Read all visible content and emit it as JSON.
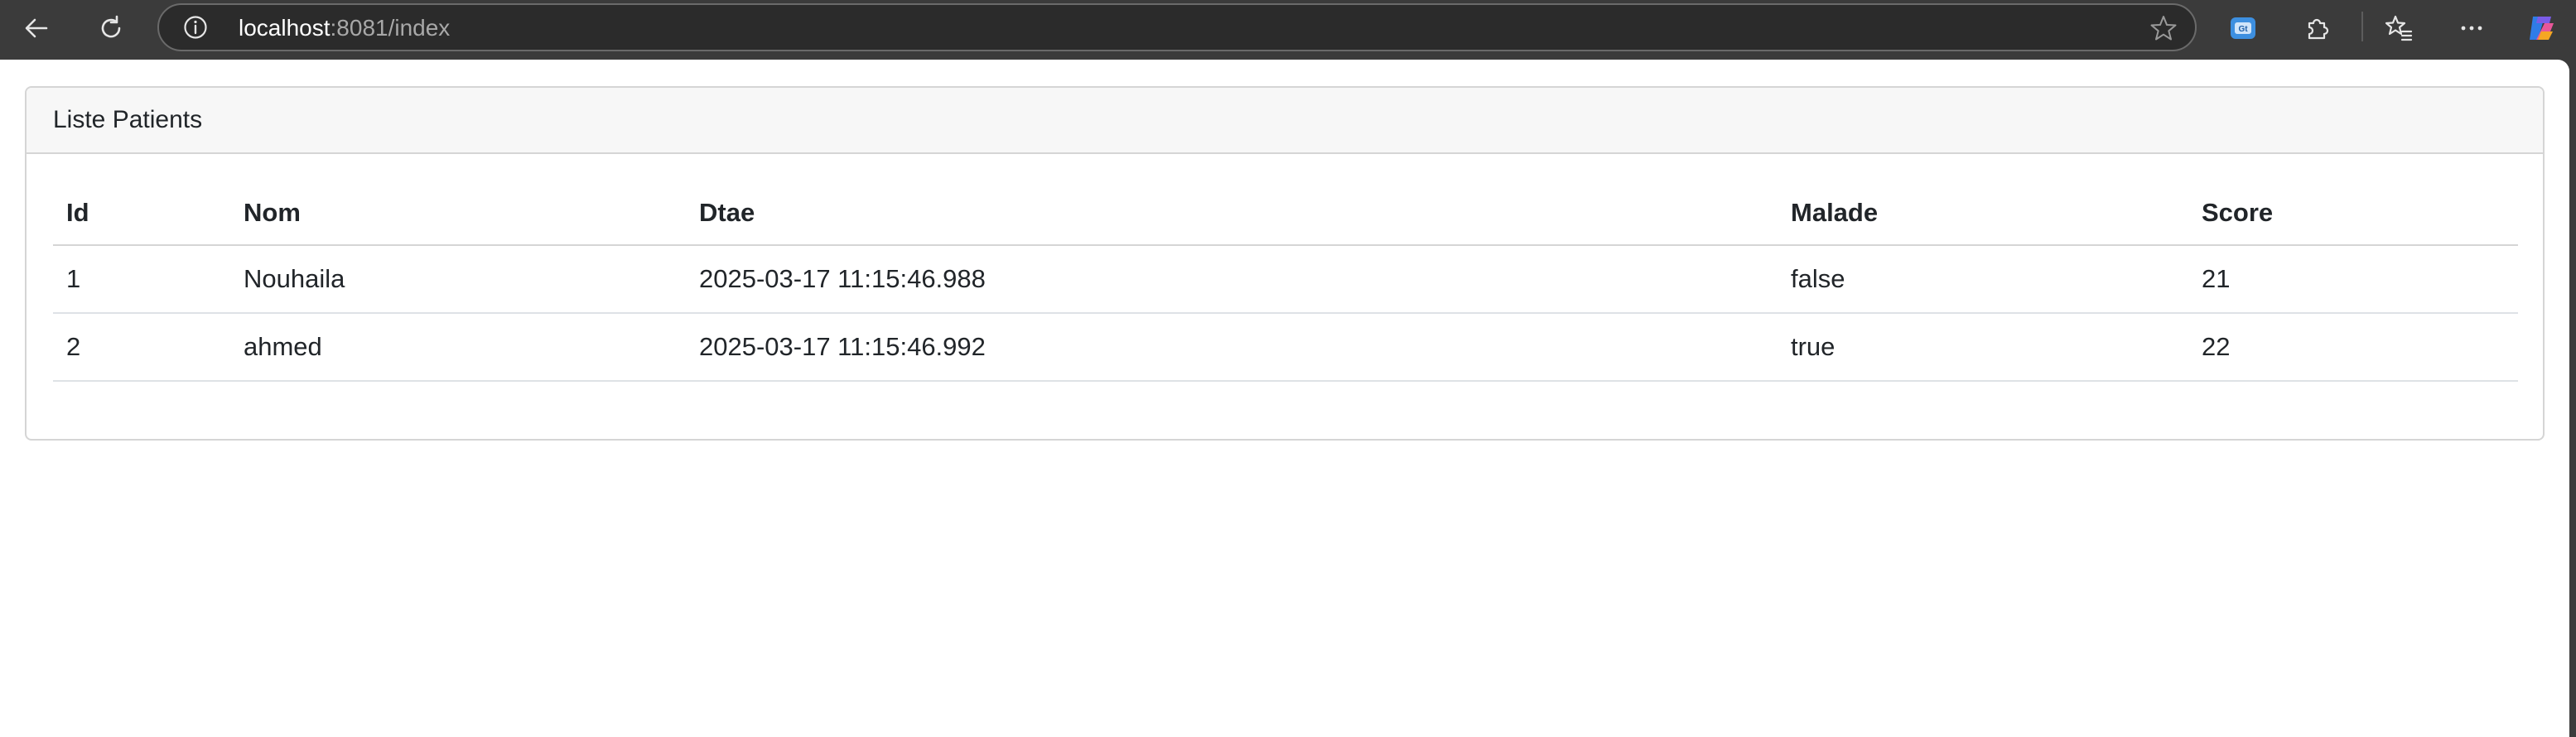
{
  "browser": {
    "url_host": "localhost",
    "url_rest": ":8081/index",
    "icons": {
      "back": "arrow-left-icon",
      "refresh": "refresh-icon",
      "info": "info-icon",
      "favorite": "star-icon",
      "extension": "extension-badge-icon",
      "extensions": "puzzle-icon",
      "favorites": "favorites-icon",
      "more": "more-icon",
      "copilot": "copilot-icon"
    }
  },
  "card": {
    "title": "Liste Patients"
  },
  "table": {
    "headers": [
      "Id",
      "Nom",
      "Dtae",
      "Malade",
      "Score"
    ],
    "rows": [
      [
        "1",
        "Nouhaila",
        "2025-03-17 11:15:46.988",
        "false",
        "21"
      ],
      [
        "2",
        "ahmed",
        "2025-03-17 11:15:46.992",
        "true",
        "22"
      ]
    ]
  },
  "colors": {
    "toolbar_bg": "#3b3b3b",
    "page_bg": "#ffffff",
    "card_header_bg": "#f7f7f7",
    "border": "#d5d5d5",
    "text": "#212529"
  }
}
